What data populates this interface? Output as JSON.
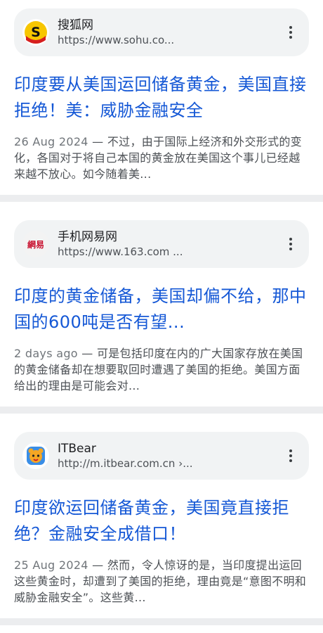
{
  "results": [
    {
      "site_name": "搜狐网",
      "url": "https://www.sohu.co...",
      "favicon": "sohu-logo",
      "title": "印度要从美国运回储备黄金，美国直接拒绝！美：威胁金融安全",
      "date": "26 Aug 2024",
      "snippet": " — 不过，由于国际上经济和外交形式的变化，各国对于将自己本国的黄金放在美国这个事儿已经越来越不放心。如今随着美..."
    },
    {
      "site_name": "手机网易网",
      "url": "https://www.163.com ...",
      "favicon": "netease-logo",
      "favicon_text": "網易",
      "title": "印度的黄金储备，美国却偏不给，那中国的600吨是否有望...",
      "date": "2 days ago",
      "snippet": " — 可是包括印度在内的广大国家存放在美国的黄金储备却在想要取回时遭遇了美国的拒绝。美国方面给出的理由是可能会对..."
    },
    {
      "site_name": "ITBear",
      "url": "http://m.itbear.com.cn ›...",
      "favicon": "itbear-logo",
      "title": "印度欲运回储备黄金，美国竟直接拒绝？金融安全成借口！",
      "date": "25 Aug 2024",
      "snippet": " — 然而，令人惊讶的是，当印度提出运回这些黄金时，却遭到了美国的拒绝，理由竟是“意图不明和威胁金融安全”。这些黄..."
    }
  ]
}
